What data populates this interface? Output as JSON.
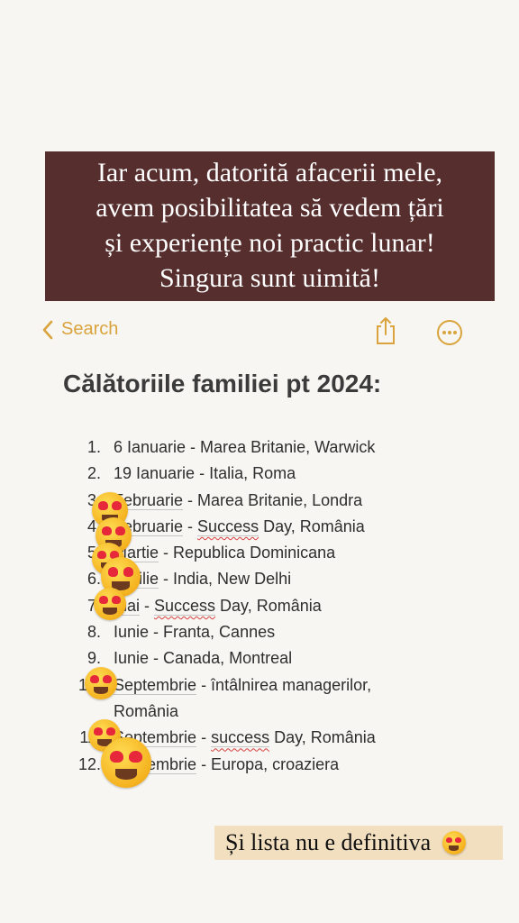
{
  "banner": {
    "lines": [
      "Iar acum, datorită afacerii mele,",
      "avem posibilitatea să vedem țări",
      "și experiențe noi practic lunar!",
      "Singura sunt uimită!"
    ]
  },
  "nav": {
    "back_label": "Search",
    "icons": [
      "chevron-left-icon",
      "share-icon",
      "more-icon"
    ],
    "accent_color": "#d9a43d"
  },
  "note": {
    "title": "Călătoriile familiei pt 2024:",
    "items": [
      {
        "num": "1.",
        "text": "6 Ianuarie - Marea Britanie, Warwick"
      },
      {
        "num": "2.",
        "text": "19 Ianuarie - Italia, Roma"
      },
      {
        "num": "3.",
        "month": "Februarie",
        "rest": " - Marea Britanie, Londra"
      },
      {
        "num": "4.",
        "month": "Februarie",
        "mid": " - ",
        "wavy": "Success",
        "rest": " Day, România"
      },
      {
        "num": "5.",
        "month": "Martie",
        "rest": " - Republica Dominicana"
      },
      {
        "num": "6.",
        "month": "Aprilie",
        "rest": " - India, New Delhi"
      },
      {
        "num": "7.",
        "month": "mai",
        "mid": " - ",
        "wavy": "Success",
        "rest": " Day, România"
      },
      {
        "num": "8.",
        "text": "Iunie - Franta, Cannes"
      },
      {
        "num": "9.",
        "text": "Iunie - Canada, Montreal"
      },
      {
        "num": "10.",
        "month": "Septembrie",
        "rest": " - întâlnirea managerilor,",
        "cont": "România"
      },
      {
        "num": "11.",
        "month": "Septembrie",
        "mid": " - ",
        "wavy": "success",
        "rest": " Day, România"
      },
      {
        "num": "12.",
        "month": "Septembrie",
        "rest": " - Europa, croaziera"
      }
    ]
  },
  "footer": {
    "text": "Și lista nu e definitiva",
    "icon": "heart-eyes-emoji-icon"
  }
}
